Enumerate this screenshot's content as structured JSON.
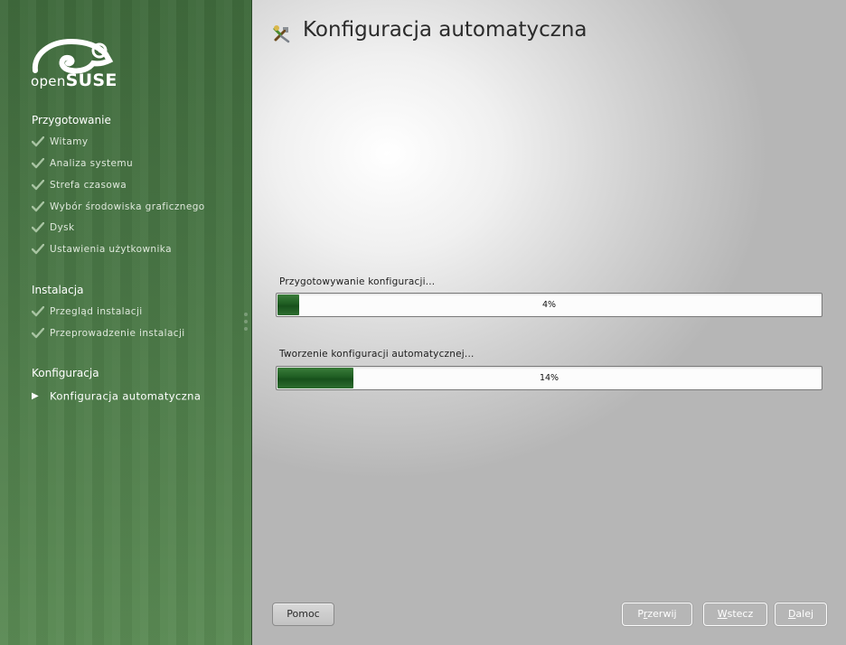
{
  "brand": {
    "open": "open",
    "suse": "SUSE"
  },
  "sidebar": {
    "sections": [
      {
        "title": "Przygotowanie",
        "steps": [
          {
            "label": "Witamy",
            "state": "done"
          },
          {
            "label": "Analiza systemu",
            "state": "done"
          },
          {
            "label": "Strefa czasowa",
            "state": "done"
          },
          {
            "label": "Wybór środowiska graficznego",
            "state": "done"
          },
          {
            "label": "Dysk",
            "state": "done"
          },
          {
            "label": "Ustawienia użytkownika",
            "state": "done"
          }
        ]
      },
      {
        "title": "Instalacja",
        "steps": [
          {
            "label": "Przegląd instalacji",
            "state": "done"
          },
          {
            "label": "Przeprowadzenie instalacji",
            "state": "done"
          }
        ]
      },
      {
        "title": "Konfiguracja",
        "steps": [
          {
            "label": "Konfiguracja automatyczna",
            "state": "current"
          }
        ]
      }
    ]
  },
  "main": {
    "title": "Konfiguracja automatyczna",
    "progress": [
      {
        "label": "Przygotowywanie konfiguracji...",
        "value": 0.04,
        "text": "4%"
      },
      {
        "label": "Tworzenie konfiguracji automatycznej...",
        "value": 0.14,
        "text": "14%"
      }
    ]
  },
  "buttons": {
    "help": "Pomoc",
    "abort": {
      "pre": "P",
      "u": "r",
      "post": "zerwij"
    },
    "back": {
      "pre": "",
      "u": "W",
      "post": "stecz"
    },
    "next": {
      "pre": "",
      "u": "D",
      "post": "alej"
    }
  },
  "colors": {
    "sidebar_green": "#4a7746",
    "progress_green": "#1f5d22",
    "check_color": "#a8c4a2"
  },
  "icons": {
    "check": "check-icon",
    "current": "play-arrow-icon",
    "title": "wizard-tools-icon"
  }
}
